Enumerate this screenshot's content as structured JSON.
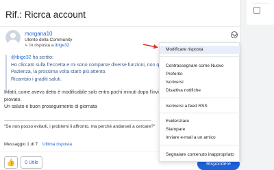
{
  "post": {
    "title": "Rif.: Ricrca account",
    "author": {
      "username": "morgana10",
      "role": "Utente della Community",
      "reply_prefix": "In risposta a",
      "reply_to": "ibige32"
    },
    "quote": {
      "mention": "@ibige32",
      "mention_suffix": " ha scritto:",
      "line2": "Ho cliccato sulla freccetta e mi sono comparse diverse funzioni, non quella di",
      "line3": "Pazienza, la prossima volta starò più attento.",
      "line4": "Ricambio i graditi saluti."
    },
    "body": {
      "line1": "Infatti, come avevo detto è modificabile solo entro pochi minuti dopo l'invio, perlo",
      "line2": "provato.",
      "line3": "Un saluto e buon proseguimento di giornata"
    },
    "signature": "\"Se non posso evitarli, i problemi li affronto, ma perchè andarseli a cercare?\"",
    "message_count": "Messaggio 1 di 7",
    "latest_reply": "Ultima risposta",
    "kudos_label": "0 Utile",
    "reply_button": "Rispondere"
  },
  "menu": {
    "items": [
      {
        "label": "Modificare risposta",
        "active": true
      },
      {
        "label": "Contrassegnare come Nuovo"
      },
      {
        "label": "Preferito"
      },
      {
        "label": "Iscriversi"
      },
      {
        "label": "Disattiva notifiche"
      },
      {
        "label": "Iscriversi a feed RSS"
      },
      {
        "label": "Evidenziare"
      },
      {
        "label": "Stampare"
      },
      {
        "label": "Inviare e-mail a un amico"
      },
      {
        "label": "Segnalare contenuto inappropriato"
      }
    ]
  },
  "colors": {
    "accent": "#1e63d8",
    "pointer": "#d9362b"
  }
}
